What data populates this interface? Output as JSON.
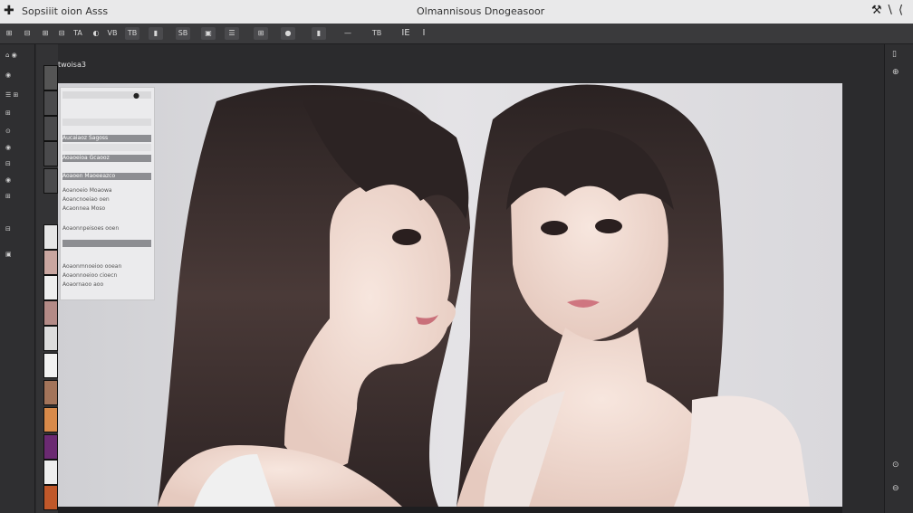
{
  "window": {
    "title_left": "Sopsiiit oion Asss",
    "title_center": "Olmannisous Dnogeasoor"
  },
  "toolbar": {
    "items": [
      "⊞",
      "⊟",
      "⊞",
      "⊟",
      "TA",
      "◐",
      "VB",
      "TB",
      "▮",
      "SB",
      "▣",
      "☰",
      "⊞",
      "●",
      "▮",
      "—",
      "TB",
      "IE",
      "I"
    ]
  },
  "left_panel": {
    "items": [
      "⌂ ◉",
      "◉",
      "☰ ⊞",
      "⊞",
      "⊙",
      "◉",
      "⊟",
      "◉",
      "⊞",
      "⊟",
      "▣"
    ]
  },
  "tab": {
    "label": "twoisa3"
  },
  "props_panel": {
    "header_button": "●",
    "rows": [
      "",
      "",
      "Aucaiaoz Sagoss",
      "",
      "Aoaoeioa Gcaooz",
      "",
      "Aoaoen Maoeeazco",
      "Aoanoeio Moaowa",
      "Aoancnoeiao oen",
      "Acaonnea Moso",
      "",
      "Aoaonnpeisoes ooen",
      "",
      "Aoaonmnoeioo ooean",
      "Aoaonnoeioo cioecn",
      "Aoaornaoo aoo"
    ]
  },
  "right_panel": {
    "icons": [
      "▯",
      "⊕",
      "⊙",
      "⊖"
    ]
  },
  "colors": {
    "skin": "#f3dfd6",
    "hair": "#3a2e2c",
    "backdrop": "#d8d7db"
  }
}
